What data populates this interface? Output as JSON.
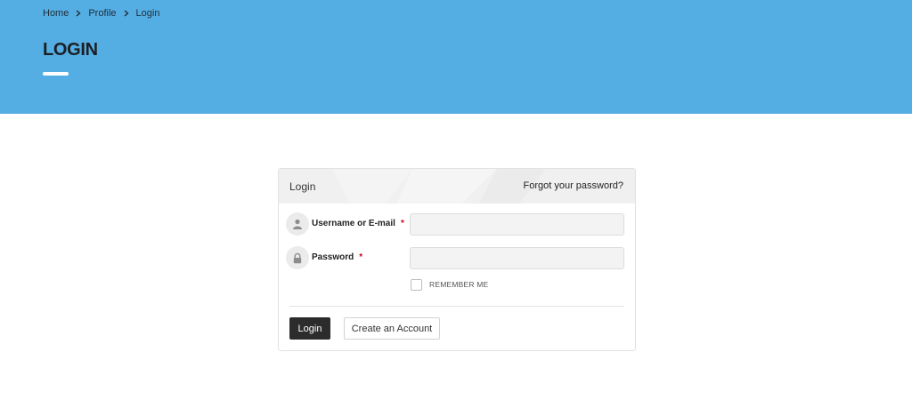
{
  "breadcrumb": {
    "items": [
      "Home",
      "Profile",
      "Login"
    ]
  },
  "page": {
    "title": "LOGIN"
  },
  "login_panel": {
    "header_title": "Login",
    "forgot_link": "Forgot your password?",
    "username_label": "Username or E-mail",
    "password_label": "Password",
    "required_mark": "*",
    "remember_me_label": "REMEMBER ME",
    "remember_me_checked": false,
    "login_button": "Login",
    "create_account_button": "Create an Account"
  },
  "colors": {
    "hero_background": "#55aee3",
    "required": "#d0021b",
    "primary_button": "#2c2c2c"
  },
  "icons": {
    "username": "user-icon",
    "password": "lock-icon",
    "breadcrumb_separator": "chevron-right-icon"
  }
}
